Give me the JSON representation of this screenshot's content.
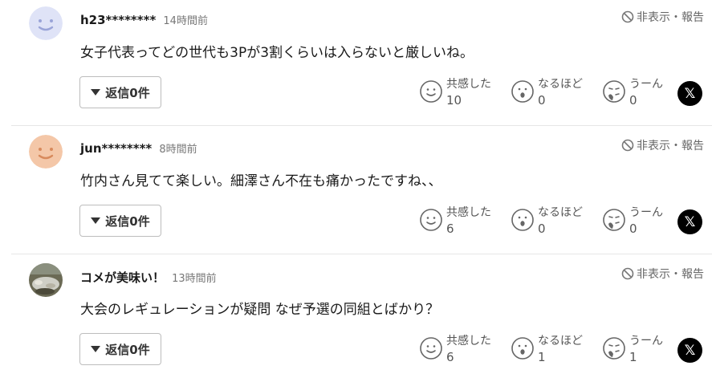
{
  "report_label": "非表示・報告",
  "reply_icon": "triangle-down-icon",
  "share_icon": "x-logo-icon",
  "share_label": "𝕏",
  "reactions": [
    "共感した",
    "なるほど",
    "うーん"
  ],
  "comments": [
    {
      "user": "h23********",
      "time": "14時間前",
      "text": "女子代表ってどの世代も3Pが3割くらいは入らないと厳しいね。",
      "reply_label": "返信0件",
      "avatar": {
        "kind": "face",
        "color": "#dfe3f7",
        "feature_color": "#9aa4d8"
      },
      "counts": [
        "10",
        "0",
        "0"
      ]
    },
    {
      "user": "jun********",
      "time": "8時間前",
      "text": "竹内さん見てて楽しい。細澤さん不在も痛かったですね、、",
      "reply_label": "返信0件",
      "avatar": {
        "kind": "face",
        "color": "#f4c7a8",
        "feature_color": "#d88a5c"
      },
      "counts": [
        "6",
        "0",
        "0"
      ]
    },
    {
      "user": "コメが美味い！",
      "time": "13時間前",
      "text": "大会のレギュレーションが疑問 なぜ予選の同組とばかり？",
      "reply_label": "返信0件",
      "avatar": {
        "kind": "photo",
        "color": "#6b6a55",
        "feature_color": "#cfcfc6"
      },
      "counts": [
        "6",
        "1",
        "1"
      ]
    }
  ]
}
